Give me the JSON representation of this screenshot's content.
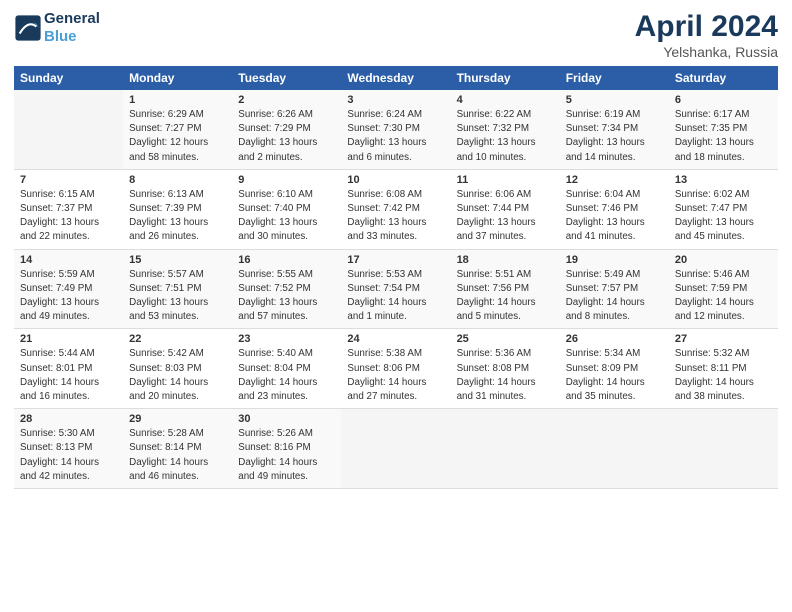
{
  "header": {
    "logo_line1": "General",
    "logo_line2": "Blue",
    "title": "April 2024",
    "subtitle": "Yelshanka, Russia"
  },
  "calendar": {
    "days_of_week": [
      "Sunday",
      "Monday",
      "Tuesday",
      "Wednesday",
      "Thursday",
      "Friday",
      "Saturday"
    ],
    "weeks": [
      [
        {
          "day": "",
          "info": ""
        },
        {
          "day": "1",
          "info": "Sunrise: 6:29 AM\nSunset: 7:27 PM\nDaylight: 12 hours\nand 58 minutes."
        },
        {
          "day": "2",
          "info": "Sunrise: 6:26 AM\nSunset: 7:29 PM\nDaylight: 13 hours\nand 2 minutes."
        },
        {
          "day": "3",
          "info": "Sunrise: 6:24 AM\nSunset: 7:30 PM\nDaylight: 13 hours\nand 6 minutes."
        },
        {
          "day": "4",
          "info": "Sunrise: 6:22 AM\nSunset: 7:32 PM\nDaylight: 13 hours\nand 10 minutes."
        },
        {
          "day": "5",
          "info": "Sunrise: 6:19 AM\nSunset: 7:34 PM\nDaylight: 13 hours\nand 14 minutes."
        },
        {
          "day": "6",
          "info": "Sunrise: 6:17 AM\nSunset: 7:35 PM\nDaylight: 13 hours\nand 18 minutes."
        }
      ],
      [
        {
          "day": "7",
          "info": "Sunrise: 6:15 AM\nSunset: 7:37 PM\nDaylight: 13 hours\nand 22 minutes."
        },
        {
          "day": "8",
          "info": "Sunrise: 6:13 AM\nSunset: 7:39 PM\nDaylight: 13 hours\nand 26 minutes."
        },
        {
          "day": "9",
          "info": "Sunrise: 6:10 AM\nSunset: 7:40 PM\nDaylight: 13 hours\nand 30 minutes."
        },
        {
          "day": "10",
          "info": "Sunrise: 6:08 AM\nSunset: 7:42 PM\nDaylight: 13 hours\nand 33 minutes."
        },
        {
          "day": "11",
          "info": "Sunrise: 6:06 AM\nSunset: 7:44 PM\nDaylight: 13 hours\nand 37 minutes."
        },
        {
          "day": "12",
          "info": "Sunrise: 6:04 AM\nSunset: 7:46 PM\nDaylight: 13 hours\nand 41 minutes."
        },
        {
          "day": "13",
          "info": "Sunrise: 6:02 AM\nSunset: 7:47 PM\nDaylight: 13 hours\nand 45 minutes."
        }
      ],
      [
        {
          "day": "14",
          "info": "Sunrise: 5:59 AM\nSunset: 7:49 PM\nDaylight: 13 hours\nand 49 minutes."
        },
        {
          "day": "15",
          "info": "Sunrise: 5:57 AM\nSunset: 7:51 PM\nDaylight: 13 hours\nand 53 minutes."
        },
        {
          "day": "16",
          "info": "Sunrise: 5:55 AM\nSunset: 7:52 PM\nDaylight: 13 hours\nand 57 minutes."
        },
        {
          "day": "17",
          "info": "Sunrise: 5:53 AM\nSunset: 7:54 PM\nDaylight: 14 hours\nand 1 minute."
        },
        {
          "day": "18",
          "info": "Sunrise: 5:51 AM\nSunset: 7:56 PM\nDaylight: 14 hours\nand 5 minutes."
        },
        {
          "day": "19",
          "info": "Sunrise: 5:49 AM\nSunset: 7:57 PM\nDaylight: 14 hours\nand 8 minutes."
        },
        {
          "day": "20",
          "info": "Sunrise: 5:46 AM\nSunset: 7:59 PM\nDaylight: 14 hours\nand 12 minutes."
        }
      ],
      [
        {
          "day": "21",
          "info": "Sunrise: 5:44 AM\nSunset: 8:01 PM\nDaylight: 14 hours\nand 16 minutes."
        },
        {
          "day": "22",
          "info": "Sunrise: 5:42 AM\nSunset: 8:03 PM\nDaylight: 14 hours\nand 20 minutes."
        },
        {
          "day": "23",
          "info": "Sunrise: 5:40 AM\nSunset: 8:04 PM\nDaylight: 14 hours\nand 23 minutes."
        },
        {
          "day": "24",
          "info": "Sunrise: 5:38 AM\nSunset: 8:06 PM\nDaylight: 14 hours\nand 27 minutes."
        },
        {
          "day": "25",
          "info": "Sunrise: 5:36 AM\nSunset: 8:08 PM\nDaylight: 14 hours\nand 31 minutes."
        },
        {
          "day": "26",
          "info": "Sunrise: 5:34 AM\nSunset: 8:09 PM\nDaylight: 14 hours\nand 35 minutes."
        },
        {
          "day": "27",
          "info": "Sunrise: 5:32 AM\nSunset: 8:11 PM\nDaylight: 14 hours\nand 38 minutes."
        }
      ],
      [
        {
          "day": "28",
          "info": "Sunrise: 5:30 AM\nSunset: 8:13 PM\nDaylight: 14 hours\nand 42 minutes."
        },
        {
          "day": "29",
          "info": "Sunrise: 5:28 AM\nSunset: 8:14 PM\nDaylight: 14 hours\nand 46 minutes."
        },
        {
          "day": "30",
          "info": "Sunrise: 5:26 AM\nSunset: 8:16 PM\nDaylight: 14 hours\nand 49 minutes."
        },
        {
          "day": "",
          "info": ""
        },
        {
          "day": "",
          "info": ""
        },
        {
          "day": "",
          "info": ""
        },
        {
          "day": "",
          "info": ""
        }
      ]
    ]
  }
}
